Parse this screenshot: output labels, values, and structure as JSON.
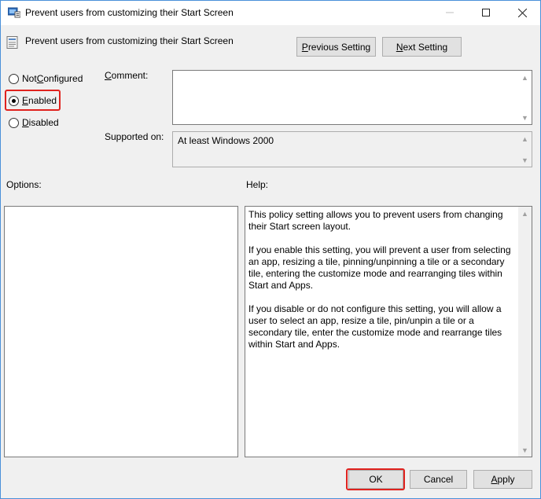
{
  "window": {
    "title": "Prevent users from customizing their Start Screen"
  },
  "header": {
    "policy_title": "Prevent users from customizing their Start Screen",
    "prev_label_pre": "",
    "prev_label_u": "P",
    "prev_label_post": "revious Setting",
    "next_label_pre": "",
    "next_label_u": "N",
    "next_label_post": "ext Setting"
  },
  "state": {
    "options": [
      {
        "u": "C",
        "pre": "Not ",
        "post": "onfigured",
        "checked": false
      },
      {
        "u": "E",
        "pre": "",
        "post": "nabled",
        "checked": true
      },
      {
        "u": "D",
        "pre": "",
        "post": "isabled",
        "checked": false
      }
    ]
  },
  "labels": {
    "comment_pre": "",
    "comment_u": "C",
    "comment_post": "omment:",
    "supported_pre": "Supported on:",
    "options": "Options:",
    "help": "Help:"
  },
  "comment": {
    "value": ""
  },
  "supported_on": {
    "value": "At least Windows 2000"
  },
  "help": {
    "paragraphs": [
      "This policy setting allows you to prevent users from changing their Start screen layout.",
      "If you enable this setting, you will prevent a user from selecting an app, resizing a tile, pinning/unpinning a tile or a secondary tile, entering the customize mode and rearranging tiles within Start and Apps.",
      "If you disable or do not configure this setting, you will allow a user to select an app, resize a tile, pin/unpin a tile or a secondary tile, enter the customize mode and rearrange tiles within Start and Apps."
    ]
  },
  "footer": {
    "ok_label": "OK",
    "cancel_label": "Cancel",
    "apply_pre": "",
    "apply_u": "A",
    "apply_post": "pply"
  },
  "colors": {
    "highlight": "#e0221e",
    "window_border": "#4a90d9",
    "button_face": "#e1e1e1"
  }
}
